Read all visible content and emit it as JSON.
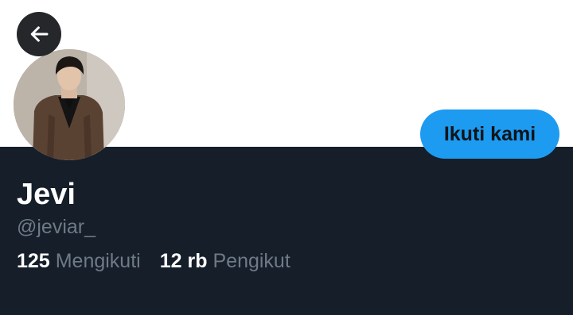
{
  "profile": {
    "display_name": "Jevi",
    "handle": "@jeviar_",
    "following_count": "125",
    "following_label": "Mengikuti",
    "followers_count": "12 rb",
    "followers_label": "Pengikut"
  },
  "actions": {
    "follow_label": "Ikuti kami"
  },
  "icons": {
    "back": "arrow-left-icon"
  },
  "colors": {
    "accent": "#1d9bf0",
    "panel_background": "#151e29",
    "secondary_text": "#6e7a86"
  }
}
